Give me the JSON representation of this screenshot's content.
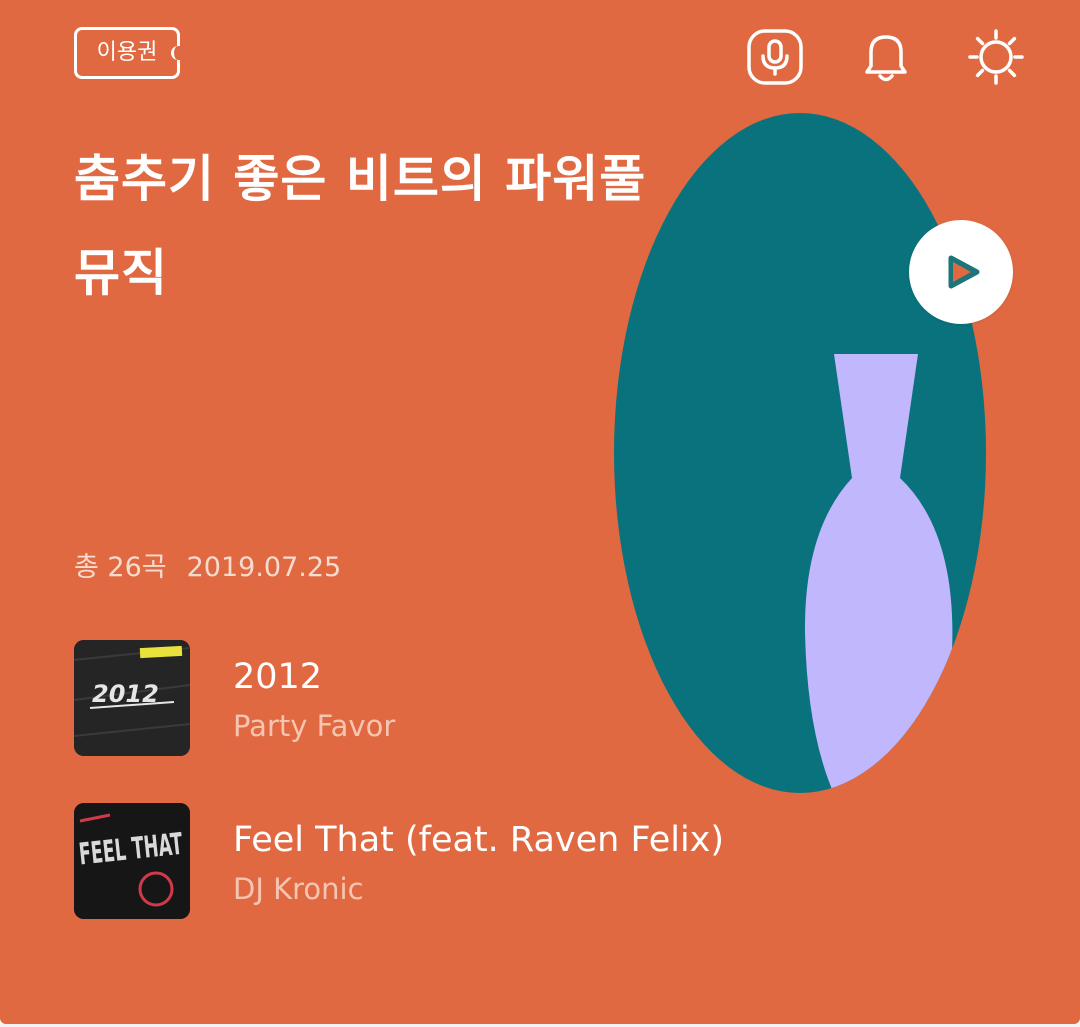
{
  "header": {
    "ticket_label": "이용권",
    "icons": [
      "mic-icon",
      "bell-icon",
      "gear-icon"
    ]
  },
  "playlist": {
    "title_line1": "춤추기 좋은 비트의 파워풀",
    "title_line2": "뮤직",
    "count": "총 26곡",
    "date": "2019.07.25",
    "play_icon": "play-icon"
  },
  "tracks": [
    {
      "title": "2012",
      "artist": "Party Favor",
      "cover_text": "2012"
    },
    {
      "title": "Feel That (feat. Raven Felix)",
      "artist": "DJ Kronic",
      "cover_text": "FEEL THAT"
    }
  ],
  "colors": {
    "background": "#e06941",
    "art_teal": "#0a727c",
    "art_vase": "#c0b7fd",
    "play_arrow": "#1d7479"
  }
}
